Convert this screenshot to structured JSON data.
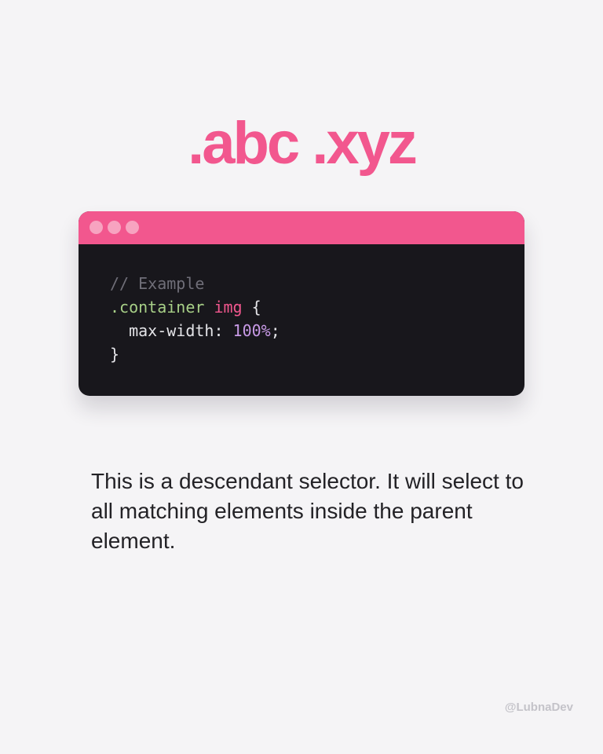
{
  "heading": ".abc .xyz",
  "code_window": {
    "lines": [
      [
        {
          "type": "comment",
          "text": "// Example"
        }
      ],
      [
        {
          "type": "class",
          "text": ".container"
        },
        {
          "type": "punct",
          "text": " "
        },
        {
          "type": "tag",
          "text": "img"
        },
        {
          "type": "punct",
          "text": " {"
        }
      ],
      [
        {
          "type": "prop",
          "text": "  max-width"
        },
        {
          "type": "punct",
          "text": ": "
        },
        {
          "type": "num",
          "text": "100%"
        },
        {
          "type": "punct",
          "text": ";"
        }
      ],
      [
        {
          "type": "punct",
          "text": "}"
        }
      ]
    ]
  },
  "description": "This is a descendant selector. It will select to all matching elements inside the parent element.",
  "watermark": "@LubnaDev",
  "colors": {
    "accent": "#f2578e",
    "code_background": "#18171c",
    "page_background": "#f5f4f6"
  }
}
